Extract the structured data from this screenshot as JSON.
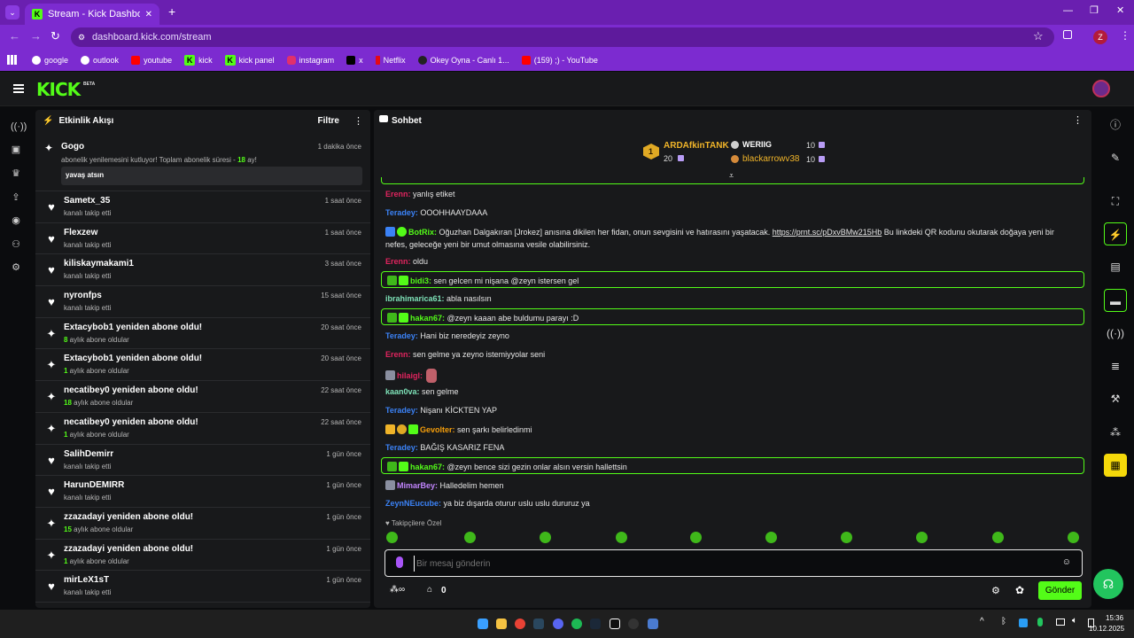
{
  "browser": {
    "tab_title": "Stream - Kick Dashboard",
    "url": "dashboard.kick.com/stream",
    "profile_initial": "Z",
    "bookmarks": [
      "google",
      "outlook",
      "youtube",
      "kick",
      "kick panel",
      "instagram",
      "x",
      "Netflix",
      "Okey Oyna - Canlı 1...",
      "(159) ;) - YouTube"
    ]
  },
  "kick": {
    "logo": "KICK",
    "beta": "BETA"
  },
  "activity": {
    "title": "Etkinlik Akışı",
    "filter_label": "Filtre",
    "featured": {
      "user": "Gogo",
      "time": "1 dakika önce",
      "text_before": "abonelik yenilemesini kutluyor! Toplam abonelik süresi - ",
      "months": "18",
      "text_after": " ay!",
      "message": "yavaş atsın"
    },
    "items": [
      {
        "icon": "heart-icon",
        "user": "Sametx_35",
        "sub_num": "",
        "sub": "kanalı takip etti",
        "time": "1 saat önce"
      },
      {
        "icon": "heart-icon",
        "user": "Flexzew",
        "sub_num": "",
        "sub": "kanalı takip etti",
        "time": "1 saat önce"
      },
      {
        "icon": "heart-icon",
        "user": "kiliskaymakami1",
        "sub_num": "",
        "sub": "kanalı takip etti",
        "time": "3 saat önce"
      },
      {
        "icon": "heart-icon",
        "user": "nyronfps",
        "sub_num": "",
        "sub": "kanalı takip etti",
        "time": "15 saat önce"
      },
      {
        "icon": "sparkle-icon",
        "user": "Extacybob1 yeniden abone oldu!",
        "sub_num": "8",
        "sub": " aylık abone oldular",
        "time": "20 saat önce"
      },
      {
        "icon": "sparkle-icon",
        "user": "Extacybob1 yeniden abone oldu!",
        "sub_num": "1",
        "sub": " aylık abone oldular",
        "time": "20 saat önce"
      },
      {
        "icon": "sparkle-icon",
        "user": "necatibey0 yeniden abone oldu!",
        "sub_num": "18",
        "sub": " aylık abone oldular",
        "time": "22 saat önce"
      },
      {
        "icon": "sparkle-icon",
        "user": "necatibey0 yeniden abone oldu!",
        "sub_num": "1",
        "sub": " aylık abone oldular",
        "time": "22 saat önce"
      },
      {
        "icon": "heart-icon",
        "user": "SalihDemirr",
        "sub_num": "",
        "sub": "kanalı takip etti",
        "time": "1 gün önce"
      },
      {
        "icon": "heart-icon",
        "user": "HarunDEMIRR",
        "sub_num": "",
        "sub": "kanalı takip etti",
        "time": "1 gün önce"
      },
      {
        "icon": "sparkle-icon",
        "user": "zzazadayi yeniden abone oldu!",
        "sub_num": "15",
        "sub": " aylık abone oldular",
        "time": "1 gün önce"
      },
      {
        "icon": "sparkle-icon",
        "user": "zzazadayi yeniden abone oldu!",
        "sub_num": "1",
        "sub": " aylık abone oldular",
        "time": "1 gün önce"
      },
      {
        "icon": "heart-icon",
        "user": "mirLeX1sT",
        "sub_num": "",
        "sub": "kanalı takip etti",
        "time": "1 gün önce"
      }
    ]
  },
  "chat": {
    "title": "Sohbet",
    "leaderboard": {
      "first": {
        "rank": "1",
        "name": "ARDAfkinTANK",
        "value": "20"
      },
      "second": {
        "name": "WERIIG",
        "value": "10"
      },
      "third": {
        "name": "blackarrowv38",
        "value": "10"
      }
    },
    "messages": [
      {
        "user": "Erenn:",
        "color": "#e0245e",
        "text": " yanlış etiket",
        "hl": false
      },
      {
        "user": "Teradey:",
        "color": "#3b82f6",
        "text": " OOOHHAAYDAAA",
        "hl": false
      },
      {
        "user": "BotRix:",
        "color": "#53fc18",
        "text": " Oğuzhan Dalgakıran [Jrokez] anısına dikilen her fidan, onun sevgisini ve hatırasını yaşatacak. ",
        "link": "https://prnt.sc/pDxvBMw215Hb",
        "text2": " Bu linkdeki QR kodunu okutarak doğaya yeni bir",
        "line2": "nefes, geleceğe yeni bir umut olmasına vesile olabilirsiniz.",
        "hl": false
      },
      {
        "user": "Erenn:",
        "color": "#e0245e",
        "text": " oldu",
        "hl": false
      },
      {
        "user": "bidi3:",
        "color": "#53fc18",
        "text": " sen gelcen mi nişana @zeyn istersen gel",
        "hl": true
      },
      {
        "user": "ibrahimarica61:",
        "color": "#7ee2b8",
        "text": " abla nasılsın",
        "hl": false
      },
      {
        "user": "hakan67:",
        "color": "#53fc18",
        "text": " @zeyn kaaan abe buldumu parayı :D",
        "hl": true
      },
      {
        "user": "Teradey:",
        "color": "#3b82f6",
        "text": " Hani biz neredeyiz zeyno",
        "hl": false
      },
      {
        "user": "Erenn:",
        "color": "#e0245e",
        "text": " sen gelme ya zeyno istemiyyolar seni",
        "hl": false
      },
      {
        "user": "hilaigl:",
        "color": "#e0245e",
        "text": "",
        "hl": false
      },
      {
        "user": "kaan0va:",
        "color": "#7ee2b8",
        "text": " sen gelme",
        "hl": false
      },
      {
        "user": "Teradey:",
        "color": "#3b82f6",
        "text": " Nişanı KİCKTEN YAP",
        "hl": false
      },
      {
        "user": "Gevolter:",
        "color": "#f59e0b",
        "text": " sen şarkı belirledinmi",
        "hl": false
      },
      {
        "user": "Teradey:",
        "color": "#3b82f6",
        "text": " BAĞIŞ KASARIZ FENA",
        "hl": false
      },
      {
        "user": "hakan67:",
        "color": "#53fc18",
        "text": " @zeyn bence sizi gezin onlar alsın versin hallettsin",
        "hl": true
      },
      {
        "user": "MimarBey:",
        "color": "#c084fc",
        "text": " Halledelim hemen",
        "hl": false
      },
      {
        "user": "ZeynNEucube:",
        "color": "#3b82f6",
        "text": " ya biz dışarda oturur uslu uslu dururuz ya",
        "hl": false
      }
    ],
    "followers_only": "Takipçilere Özel",
    "input_placeholder": "Bir mesaj gönderin",
    "points": "0",
    "send_label": "Gönder"
  },
  "taskbar": {
    "time": "15:36",
    "date": "10.12.2025"
  },
  "colors": {
    "accent": "#53fc18",
    "browser": "#7c2bd0",
    "panel": "#18191b"
  }
}
